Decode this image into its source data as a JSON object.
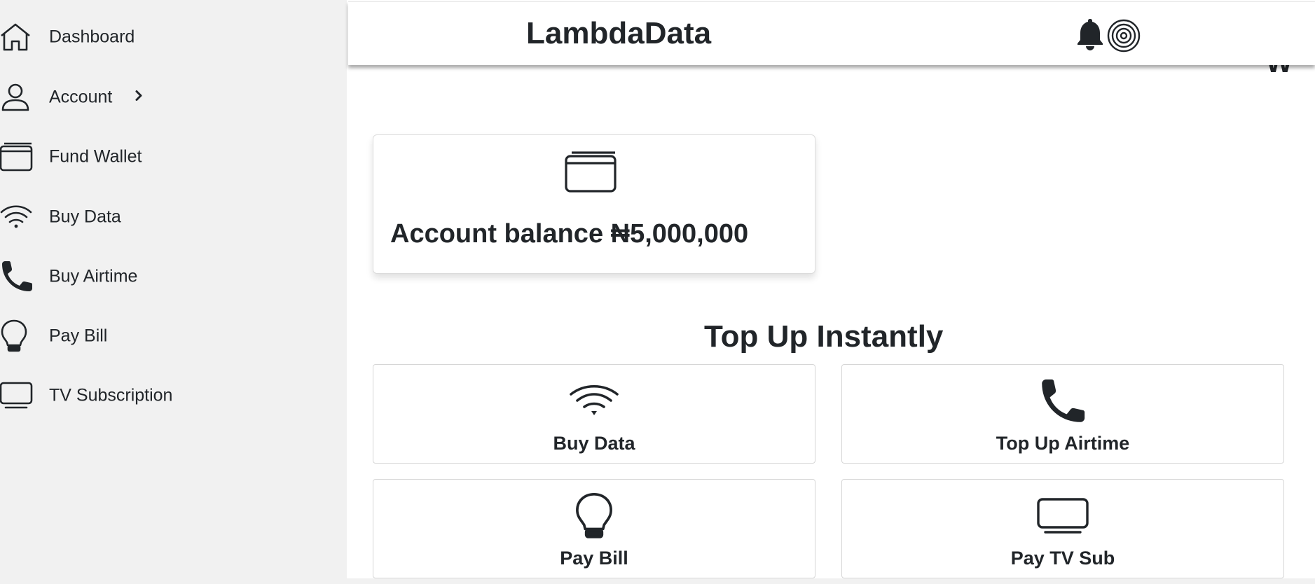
{
  "sidebar": {
    "items": [
      {
        "label": "Dashboard",
        "icon": "home-icon"
      },
      {
        "label": "Account",
        "icon": "user-icon"
      },
      {
        "label": "Fund Wallet",
        "icon": "wallet-icon"
      },
      {
        "label": "Buy Data",
        "icon": "wifi-icon"
      },
      {
        "label": "Buy Airtime",
        "icon": "phone-icon"
      },
      {
        "label": "Pay Bill",
        "icon": "lightbulb-icon"
      },
      {
        "label": "TV Subscription",
        "icon": "tv-icon"
      }
    ]
  },
  "header": {
    "brand": "LambdaData",
    "notification_icon": "bell-icon",
    "profile_icon": "target-icon"
  },
  "stray_text": "W",
  "balance": {
    "text": "Account balance ₦5,000,000",
    "icon": "wallet-icon"
  },
  "topup": {
    "title": "Top Up Instantly",
    "tiles": [
      {
        "label": "Buy Data",
        "icon": "wifi-icon"
      },
      {
        "label": "Top Up Airtime",
        "icon": "phone-icon"
      },
      {
        "label": "Pay Bill",
        "icon": "lightbulb-icon"
      },
      {
        "label": "Pay TV Sub",
        "icon": "tv-icon"
      }
    ]
  },
  "colors": {
    "text": "#212529",
    "sidebar_bg": "#f1f1f1",
    "card_border": "#d6d6d6"
  }
}
